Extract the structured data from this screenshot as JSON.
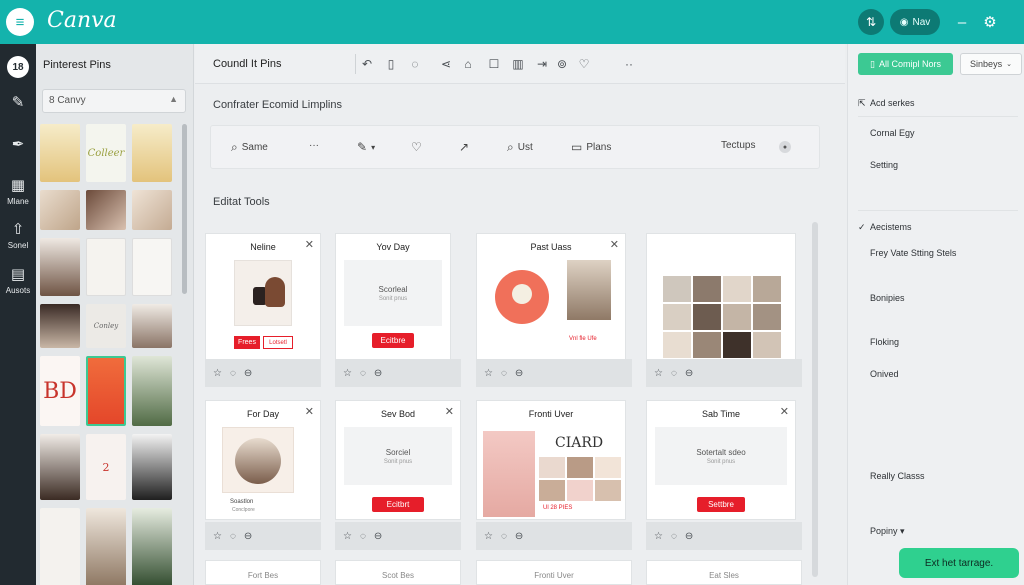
{
  "topbar": {
    "brand": "Canva",
    "logo_icon": "layers-icon",
    "share_icon": "upload-icon",
    "new_label": "Nav",
    "minimize_icon": "minus-icon",
    "settings_icon": "gear-icon"
  },
  "rail": {
    "home_label": "18",
    "items": [
      {
        "icon": "brush-icon",
        "label": ""
      },
      {
        "icon": "pen-icon",
        "label": ""
      },
      {
        "icon": "media-icon",
        "label": "Mlane"
      },
      {
        "icon": "upload-icon",
        "label": "Sonel"
      },
      {
        "icon": "assets-icon",
        "label": "Ausots"
      }
    ]
  },
  "library": {
    "title": "Pinterest Pins",
    "search_value": "8 Canvy"
  },
  "workspace": {
    "title": "Coundl It Pins",
    "subtitle": "Confrater Ecomid Limplins",
    "section_title": "Editat Tools",
    "toolbar": {
      "save": "Same",
      "more": "···",
      "search": "Ust",
      "plans": "Plans",
      "settings": "Tectups"
    },
    "cards_row1": [
      {
        "title": "Neline",
        "buttons": [
          "Frees",
          "Lotsetl"
        ]
      },
      {
        "title": "Yov Day",
        "body": "Scorleal",
        "body_sub": "Sonit pnus",
        "button": "Ecitbre"
      },
      {
        "title": "Past Uass",
        "caption": "Vnl fle Ufe"
      },
      {
        "title": ""
      }
    ],
    "cards_row2": [
      {
        "title": "For Day",
        "caption": "Soastlon",
        "caption2": "Conclpore"
      },
      {
        "title": "Sev Bod",
        "body": "Sorciel",
        "body_sub": "Sonit pnus",
        "button": "Ecitbrt"
      },
      {
        "title": "Fronti Uver",
        "poster_text": "CIARD",
        "caption": "Ul 28 PIES"
      },
      {
        "title": "Sab Time",
        "body": "Sotertalt sdeo",
        "body_sub": "Sonit pnus",
        "button": "Settbre"
      }
    ],
    "peek_titles": [
      "Fort Bes",
      "Scot Bes",
      "Fronti Uver",
      "Eat Sles"
    ]
  },
  "right_panel": {
    "primary_button": "All Comipl Nors",
    "select_value": "Sinbeys",
    "items": [
      {
        "label": "Acd serkes",
        "type": "back"
      },
      {
        "label": "Cornal Egy",
        "type": "plain"
      },
      {
        "label": "Setting",
        "type": "plain"
      },
      {
        "label": "Aecistems",
        "type": "check"
      },
      {
        "label": "Frey Vate Stting Stels",
        "type": "plain"
      },
      {
        "label": "Bonipies",
        "type": "plain"
      },
      {
        "label": "Floking",
        "type": "plain"
      },
      {
        "label": "Onived",
        "type": "plain"
      },
      {
        "label": "Really Classs",
        "type": "plain"
      },
      {
        "label": "Popiny ▾",
        "type": "plain"
      }
    ]
  },
  "toast": {
    "label": "Ext het tarrage."
  },
  "colors": {
    "topbar": "#14b3ac",
    "rail": "#222a30",
    "accent_green": "#3cc993",
    "action_red": "#e61e2a"
  }
}
